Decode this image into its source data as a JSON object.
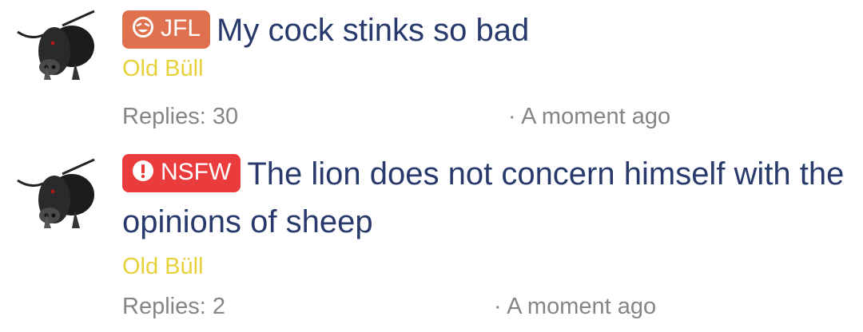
{
  "threads": [
    {
      "badge_label": "JFL",
      "badge_icon": "laughing-face-icon",
      "badge_color": "#e0714f",
      "title": "My cock stinks so bad",
      "author": "Old Büll",
      "replies": "Replies: 30",
      "time": "· A moment ago"
    },
    {
      "badge_label": "NSFW",
      "badge_icon": "exclamation-icon",
      "badge_color": "#ea3c3c",
      "title": "The lion does not concern himself with the opinions of sheep",
      "author": "Old Büll",
      "replies": "Replies: 2",
      "time": "· A moment ago"
    }
  ],
  "colors": {
    "title": "#283a6b",
    "author": "#e6d13a",
    "meta": "#858585"
  }
}
